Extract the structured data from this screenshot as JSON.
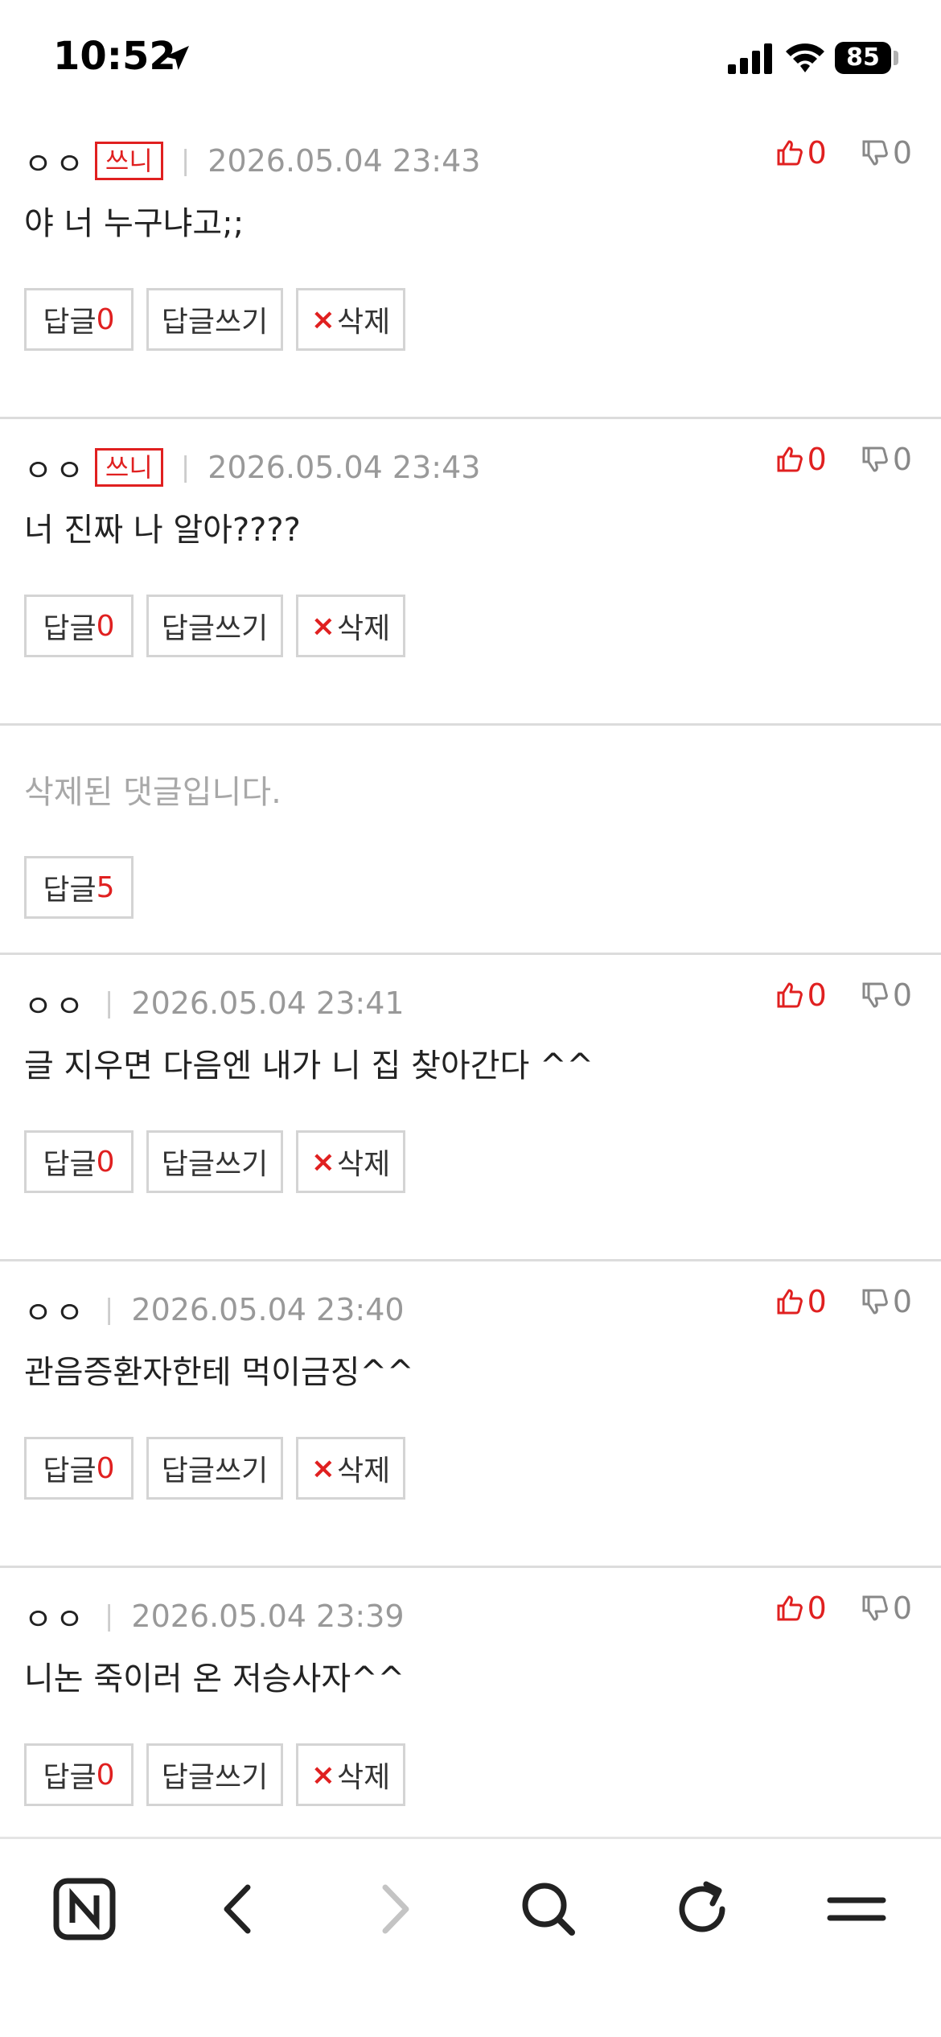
{
  "status_bar": {
    "time": "10:52",
    "battery": "85",
    "icons": [
      "location-arrow-icon",
      "cellular-signal-icon",
      "wifi-icon",
      "battery-icon"
    ]
  },
  "colors": {
    "accent_red": "#e02020",
    "muted_gray": "#999999",
    "border_gray": "#d4d4d4"
  },
  "labels": {
    "writer_badge": "쓰니",
    "separator": "|",
    "reply": "답글",
    "write_reply": "답글쓰기",
    "delete": "삭제",
    "delete_mark": "×"
  },
  "comments": [
    {
      "nick": "ㅇㅇ",
      "is_writer": true,
      "date": "2026.05.04 23:43",
      "text": "야 너 누구냐고;;",
      "reply_count": "0",
      "up": "0",
      "down": "0"
    },
    {
      "nick": "ㅇㅇ",
      "is_writer": true,
      "date": "2026.05.04 23:43",
      "text": "너 진짜 나 알아????",
      "reply_count": "0",
      "up": "0",
      "down": "0"
    },
    {
      "deleted": true,
      "text": "삭제된 댓글입니다.",
      "reply_count": "5"
    },
    {
      "nick": "ㅇㅇ",
      "is_writer": false,
      "date": "2026.05.04 23:41",
      "text": "글 지우면 다음엔 내가 니 집 찾아간다 ^^",
      "reply_count": "0",
      "up": "0",
      "down": "0"
    },
    {
      "nick": "ㅇㅇ",
      "is_writer": false,
      "date": "2026.05.04 23:40",
      "text": "관음증환자한테 먹이금징^^",
      "reply_count": "0",
      "up": "0",
      "down": "0"
    },
    {
      "nick": "ㅇㅇ",
      "is_writer": false,
      "date": "2026.05.04 23:39",
      "text": "니논 죽이러 온 저승사자^^",
      "reply_count": "0",
      "up": "0",
      "down": "0"
    }
  ],
  "toolbar": {
    "icons": [
      "naver-home-icon",
      "back-arrow-icon",
      "forward-arrow-icon",
      "search-icon",
      "reload-icon",
      "menu-icon"
    ]
  }
}
